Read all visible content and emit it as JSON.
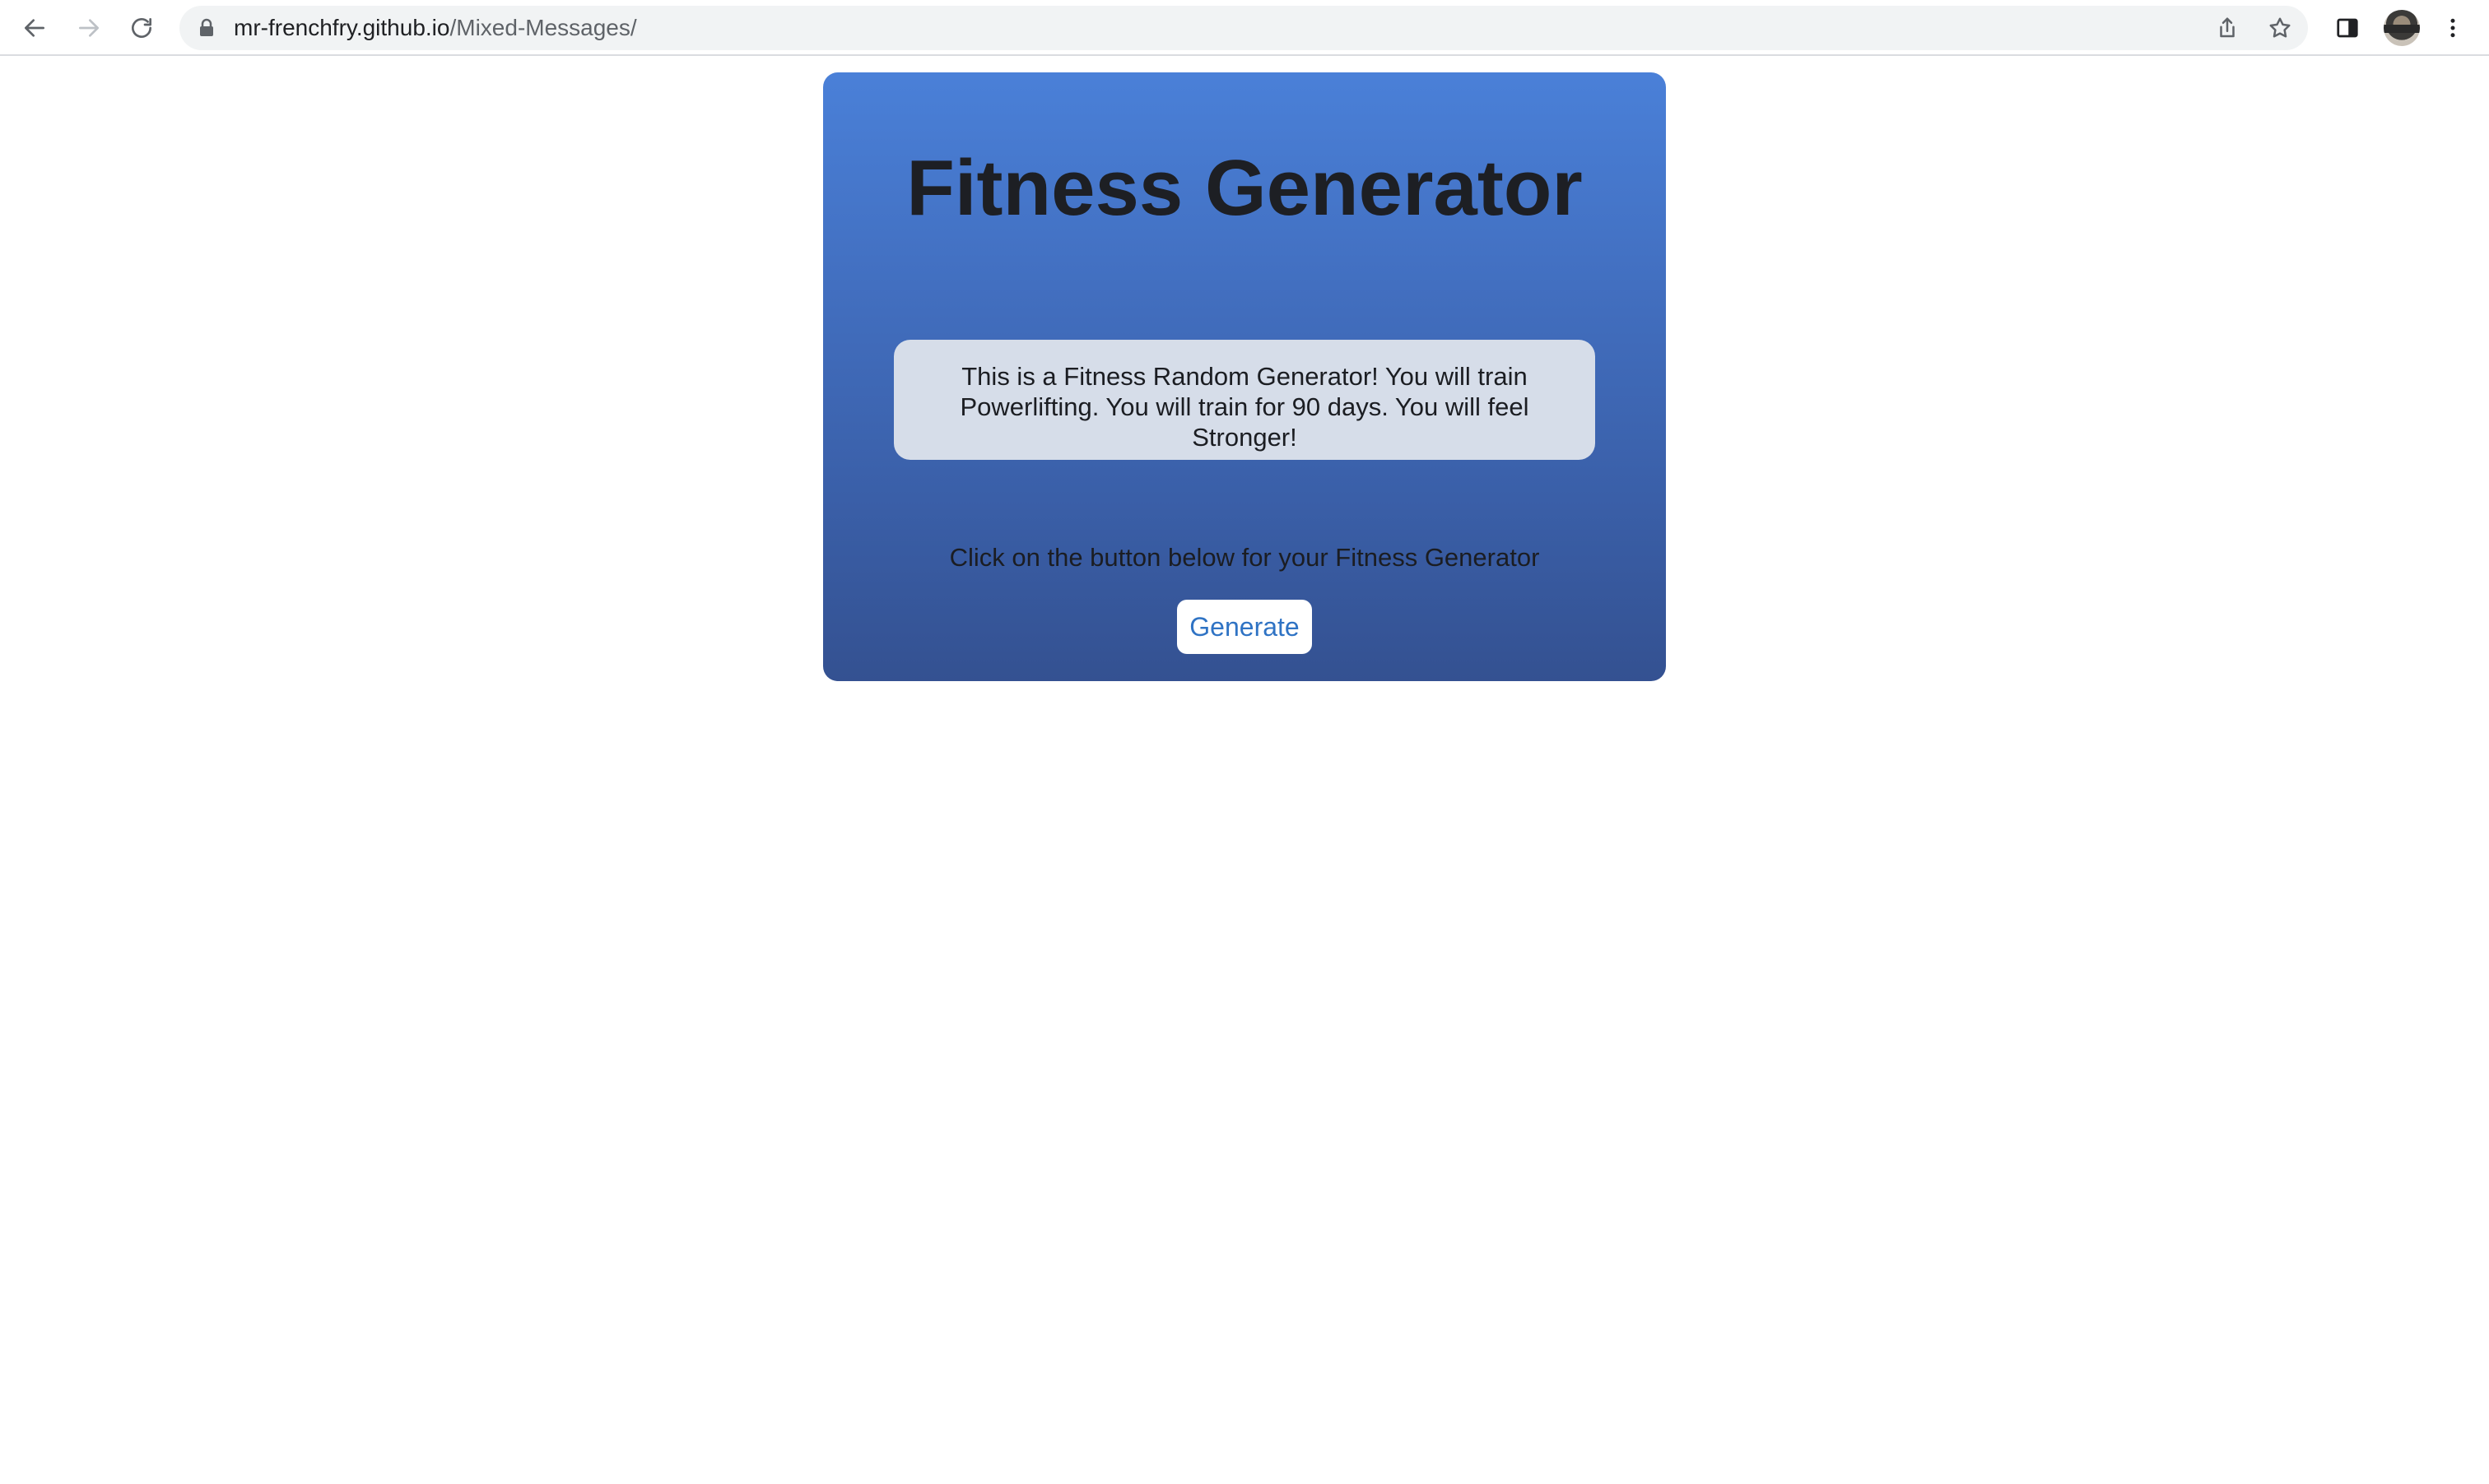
{
  "browser": {
    "url_domain": "mr-frenchfry.github.io",
    "url_path": "/Mixed-Messages/",
    "icons": {
      "back": "arrow-left-icon",
      "forward": "arrow-right-icon",
      "reload": "reload-icon",
      "lock": "lock-icon",
      "share": "share-icon",
      "bookmark": "star-icon",
      "side_panel": "side-panel-icon",
      "profile": "avatar",
      "menu": "kebab-menu-icon"
    }
  },
  "page": {
    "title": "Fitness Generator",
    "message": "This is a Fitness Random Generator! You will train Powerlifting. You will train for 90 days. You will feel Stronger!",
    "instruction": "Click on the button below for your Fitness Generator",
    "button_label": "Generate"
  },
  "colors": {
    "card_gradient_top": "#4a80d8",
    "card_gradient_bottom": "#345191",
    "message_bg": "#d6dde9",
    "button_text": "#2f73c4",
    "title_text": "#1d1f24"
  }
}
